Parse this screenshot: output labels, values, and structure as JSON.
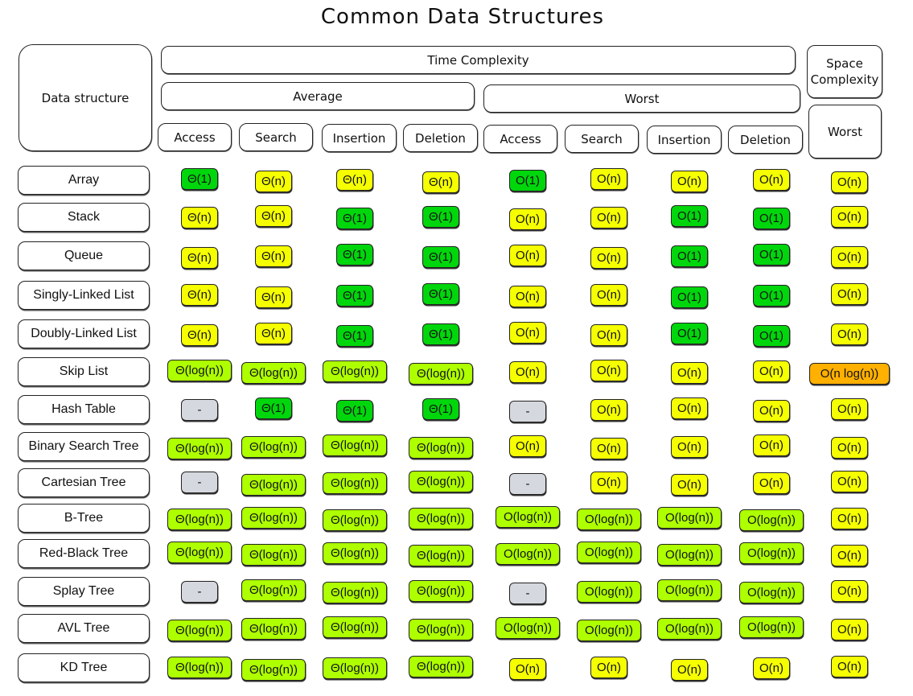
{
  "title": "Common Data Structures",
  "headers": {
    "data_structure": "Data structure",
    "time_complexity": "Time Complexity",
    "space_complexity": "Space Complexity",
    "average": "Average",
    "worst": "Worst",
    "space_worst": "Worst",
    "operations": [
      "Access",
      "Search",
      "Insertion",
      "Deletion"
    ]
  },
  "colors": {
    "constant": "#00d60c",
    "linear": "#f5ff00",
    "logarithmic": "#aeff00",
    "not_applicable": "#d5d8de",
    "linearithmic": "#ffb000"
  },
  "rows": [
    {
      "name": "Array",
      "cells": [
        "Θ(1)",
        "Θ(n)",
        "Θ(n)",
        "Θ(n)",
        "O(1)",
        "O(n)",
        "O(n)",
        "O(n)",
        "O(n)"
      ]
    },
    {
      "name": "Stack",
      "cells": [
        "Θ(n)",
        "Θ(n)",
        "Θ(1)",
        "Θ(1)",
        "O(n)",
        "O(n)",
        "O(1)",
        "O(1)",
        "O(n)"
      ]
    },
    {
      "name": "Queue",
      "cells": [
        "Θ(n)",
        "Θ(n)",
        "Θ(1)",
        "Θ(1)",
        "O(n)",
        "O(n)",
        "O(1)",
        "O(1)",
        "O(n)"
      ]
    },
    {
      "name": "Singly-Linked List",
      "cells": [
        "Θ(n)",
        "Θ(n)",
        "Θ(1)",
        "Θ(1)",
        "O(n)",
        "O(n)",
        "O(1)",
        "O(1)",
        "O(n)"
      ]
    },
    {
      "name": "Doubly-Linked List",
      "cells": [
        "Θ(n)",
        "Θ(n)",
        "Θ(1)",
        "Θ(1)",
        "O(n)",
        "O(n)",
        "O(1)",
        "O(1)",
        "O(n)"
      ]
    },
    {
      "name": "Skip List",
      "cells": [
        "Θ(log(n))",
        "Θ(log(n))",
        "Θ(log(n))",
        "Θ(log(n))",
        "O(n)",
        "O(n)",
        "O(n)",
        "O(n)",
        "O(n log(n))"
      ]
    },
    {
      "name": "Hash Table",
      "cells": [
        "-",
        "Θ(1)",
        "Θ(1)",
        "Θ(1)",
        "-",
        "O(n)",
        "O(n)",
        "O(n)",
        "O(n)"
      ]
    },
    {
      "name": "Binary Search Tree",
      "cells": [
        "Θ(log(n))",
        "Θ(log(n))",
        "Θ(log(n))",
        "Θ(log(n))",
        "O(n)",
        "O(n)",
        "O(n)",
        "O(n)",
        "O(n)"
      ]
    },
    {
      "name": "Cartesian Tree",
      "cells": [
        "-",
        "Θ(log(n))",
        "Θ(log(n))",
        "Θ(log(n))",
        "-",
        "O(n)",
        "O(n)",
        "O(n)",
        "O(n)"
      ]
    },
    {
      "name": "B-Tree",
      "cells": [
        "Θ(log(n))",
        "Θ(log(n))",
        "Θ(log(n))",
        "Θ(log(n))",
        "O(log(n))",
        "O(log(n))",
        "O(log(n))",
        "O(log(n))",
        "O(n)"
      ]
    },
    {
      "name": "Red-Black Tree",
      "cells": [
        "Θ(log(n))",
        "Θ(log(n))",
        "Θ(log(n))",
        "Θ(log(n))",
        "O(log(n))",
        "O(log(n))",
        "O(log(n))",
        "O(log(n))",
        "O(n)"
      ]
    },
    {
      "name": "Splay Tree",
      "cells": [
        "-",
        "Θ(log(n))",
        "Θ(log(n))",
        "Θ(log(n))",
        "-",
        "O(log(n))",
        "O(log(n))",
        "O(log(n))",
        "O(n)"
      ]
    },
    {
      "name": "AVL Tree",
      "cells": [
        "Θ(log(n))",
        "Θ(log(n))",
        "Θ(log(n))",
        "Θ(log(n))",
        "O(log(n))",
        "O(log(n))",
        "O(log(n))",
        "O(log(n))",
        "O(n)"
      ]
    },
    {
      "name": "KD Tree",
      "cells": [
        "Θ(log(n))",
        "Θ(log(n))",
        "Θ(log(n))",
        "Θ(log(n))",
        "O(n)",
        "O(n)",
        "O(n)",
        "O(n)",
        "O(n)"
      ]
    }
  ]
}
